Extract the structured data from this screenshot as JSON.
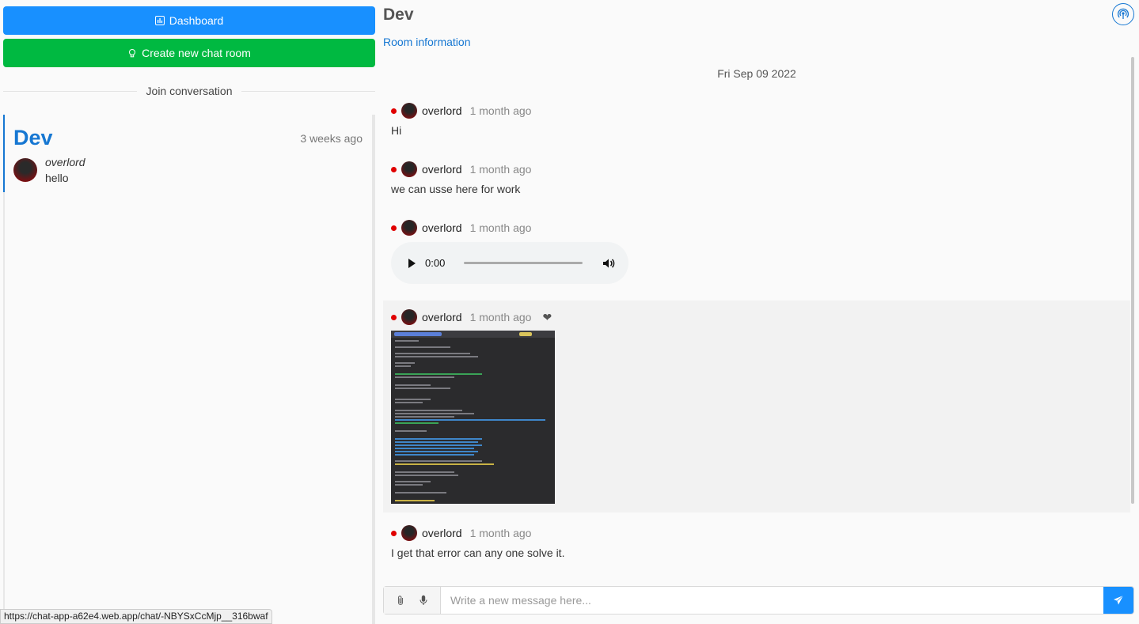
{
  "sidebar": {
    "dashboard_label": "Dashboard",
    "create_room_label": "Create new chat room",
    "join_label": "Join conversation",
    "rooms": [
      {
        "title": "Dev",
        "time": "3 weeks ago",
        "author": "overlord",
        "last_message": "hello"
      }
    ]
  },
  "chat": {
    "title": "Dev",
    "room_info_link": "Room information",
    "date": "Fri Sep 09 2022",
    "messages": [
      {
        "user": "overlord",
        "time": "1 month ago",
        "text": "Hi"
      },
      {
        "user": "overlord",
        "time": "1 month ago",
        "text": "we can usse here for work"
      },
      {
        "user": "overlord",
        "time": "1 month ago",
        "audio_time": "0:00"
      },
      {
        "user": "overlord",
        "time": "1 month ago",
        "image": "terminal-screenshot"
      },
      {
        "user": "overlord",
        "time": "1 month ago",
        "text": "I get that error can any one solve it."
      }
    ]
  },
  "composer": {
    "placeholder": "Write a new message here..."
  },
  "status_bar": {
    "url": "https://chat-app-a62e4.web.app/chat/-NBYSxCcMjp__316bwaf"
  },
  "colors": {
    "primary": "#1890ff",
    "success": "#00b941",
    "link": "#1677d2",
    "online_dot": "#e00000"
  }
}
